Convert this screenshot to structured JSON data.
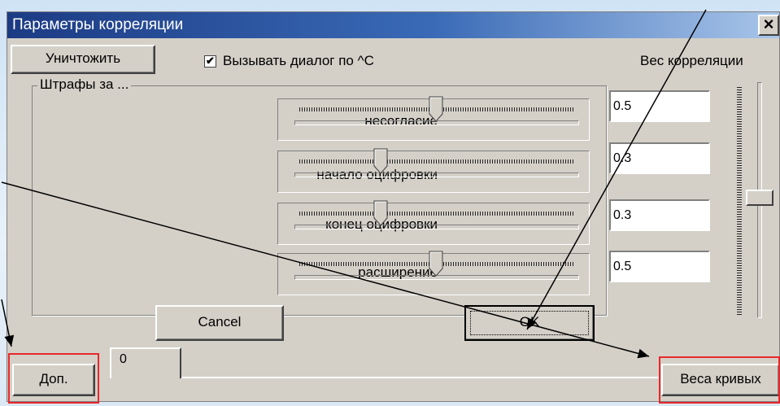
{
  "window": {
    "title": "Параметры корреляции",
    "close_label": "×"
  },
  "buttons": {
    "destroy": "Уничтожить",
    "cancel": "Cancel",
    "ok": "OK",
    "extra": "Доп.",
    "curve_weights": "Веса кривых"
  },
  "checkbox": {
    "label": "Вызывать диалог по ^C",
    "checked": true,
    "mark": "✔"
  },
  "correlation_weight": {
    "label": "Вес корреляции",
    "level": 0.52
  },
  "penalties": {
    "group_title": "Штрафы за ...",
    "rows": [
      {
        "label": "несогласие",
        "value": "0.5",
        "slider": 0.5
      },
      {
        "label": "начало оцифровки",
        "value": "0.3",
        "slider": 0.3
      },
      {
        "label": "конец оцифровки",
        "value": "0.3",
        "slider": 0.3
      },
      {
        "label": "расширение",
        "value": "0.5",
        "slider": 0.5
      }
    ]
  },
  "tab": {
    "label": "0"
  },
  "colors": {
    "highlight": "#e8282c",
    "title_start": "#1c3b84",
    "title_end": "#a9c6ea",
    "face": "#d4d0c8"
  }
}
